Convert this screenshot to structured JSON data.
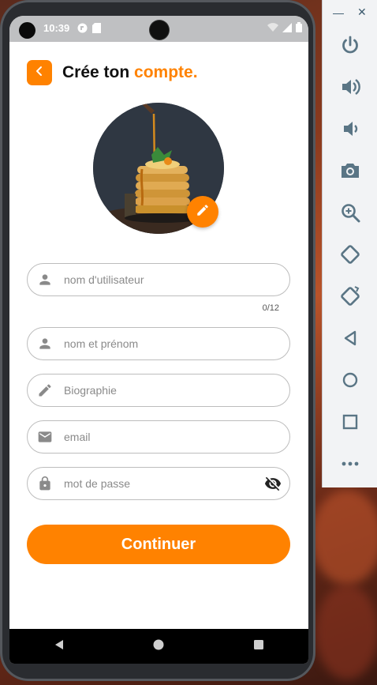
{
  "status_bar": {
    "time": "10:39"
  },
  "header": {
    "title_part1": "Crée ton ",
    "title_accent": "compte."
  },
  "form": {
    "username": {
      "placeholder": "nom d'utilisateur",
      "value": "",
      "counter": "0/12"
    },
    "fullname": {
      "placeholder": "nom et prénom",
      "value": ""
    },
    "bio": {
      "placeholder": "Biographie",
      "value": ""
    },
    "email": {
      "placeholder": "email",
      "value": ""
    },
    "password": {
      "placeholder": "mot de passe",
      "value": ""
    }
  },
  "continue_label": "Continuer",
  "icons": {
    "back": "chevron-left-icon",
    "edit": "pencil-icon",
    "user": "person-icon",
    "bio": "pencil-icon",
    "email": "mail-icon",
    "password": "lock-icon",
    "visibility": "eye-off-icon"
  },
  "emulator_toolbar": {
    "buttons": [
      "power",
      "volume-up",
      "volume-down",
      "camera",
      "zoom",
      "rotate-left",
      "rotate-right",
      "back",
      "home",
      "overview",
      "more"
    ]
  },
  "colors": {
    "accent": "#ff8200",
    "field_border": "#bdbdbd",
    "text": "#111111"
  }
}
